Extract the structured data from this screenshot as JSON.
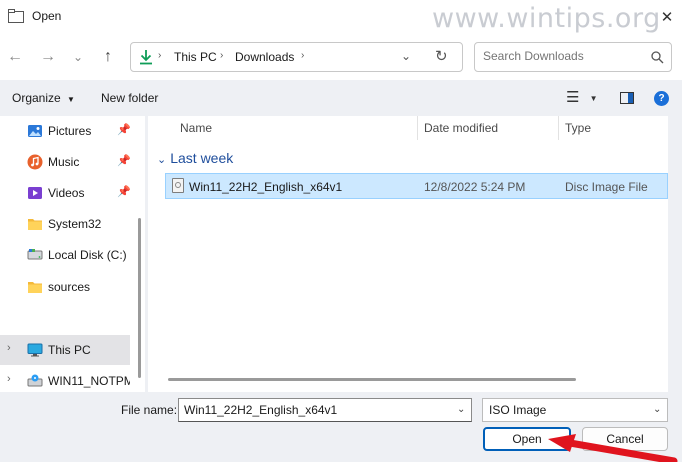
{
  "window": {
    "title": "Open",
    "watermark": "www.wintips.org"
  },
  "nav": {
    "breadcrumb": [
      "This PC",
      "Downloads"
    ],
    "search_placeholder": "Search Downloads"
  },
  "toolbar": {
    "organize_label": "Organize",
    "new_folder_label": "New folder"
  },
  "sidebar": {
    "items": [
      {
        "label": "Pictures",
        "icon": "pictures-icon",
        "pinned": true
      },
      {
        "label": "Music",
        "icon": "music-icon",
        "pinned": true
      },
      {
        "label": "Videos",
        "icon": "videos-icon",
        "pinned": true
      },
      {
        "label": "System32",
        "icon": "folder-icon",
        "pinned": false
      },
      {
        "label": "Local Disk (C:)",
        "icon": "drive-icon",
        "pinned": false
      },
      {
        "label": "sources",
        "icon": "folder-icon",
        "pinned": false
      },
      {
        "label": "This PC",
        "icon": "monitor-icon",
        "selected": true
      },
      {
        "label": "WIN11_NOTPM",
        "icon": "disc-drive-icon"
      }
    ]
  },
  "filelist": {
    "columns": [
      "Name",
      "Date modified",
      "Type"
    ],
    "group_label": "Last week",
    "rows": [
      {
        "name": "Win11_22H2_English_x64v1",
        "date": "12/8/2022 5:24 PM",
        "type": "Disc Image File",
        "selected": true
      }
    ]
  },
  "footer": {
    "filename_label": "File name:",
    "filename_value": "Win11_22H2_English_x64v1",
    "filetype_value": "ISO Image",
    "open_label": "Open",
    "cancel_label": "Cancel"
  },
  "colors": {
    "accent": "#005fb8",
    "selection": "#cce8ff",
    "annotation_arrow": "#e0141e"
  }
}
